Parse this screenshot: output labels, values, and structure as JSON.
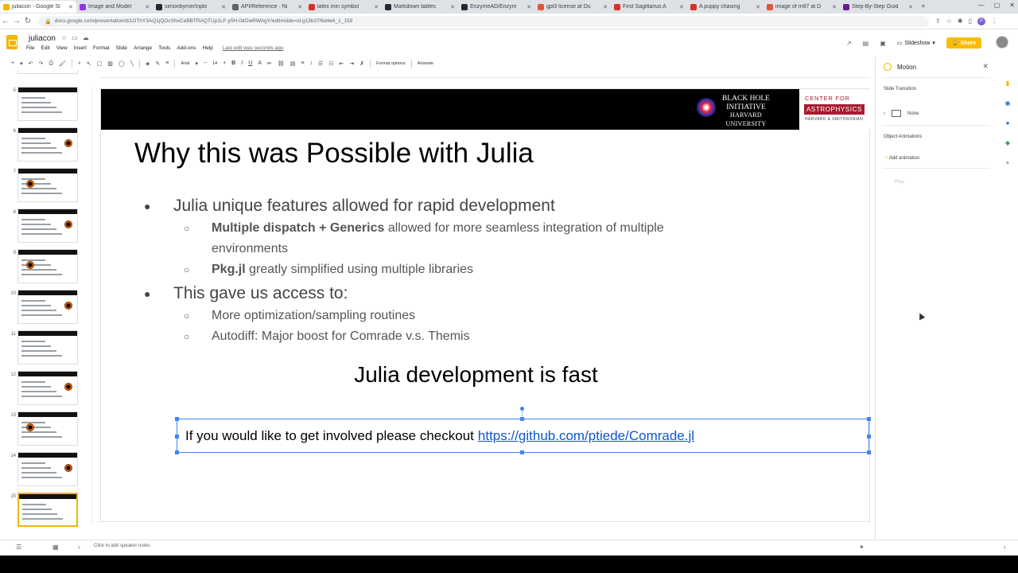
{
  "browser": {
    "tabs": [
      {
        "title": "juliacon - Google Sl",
        "color": "#f4b400",
        "active": true
      },
      {
        "title": "Image and Model",
        "color": "#9334e6"
      },
      {
        "title": "simonbyrne/Inplo",
        "color": "#24292f"
      },
      {
        "title": "API/Reference · Ni",
        "color": "#5f6368"
      },
      {
        "title": "latex min symbol",
        "color": "#d93025"
      },
      {
        "title": "Markdown tables",
        "color": "#24292f"
      },
      {
        "title": "EnzymeAD/Enzym",
        "color": "#24292f"
      },
      {
        "title": "gpl3 license at Du",
        "color": "#de5833"
      },
      {
        "title": "First Sagittarius A",
        "color": "#d93025"
      },
      {
        "title": "A puppy chasing",
        "color": "#d93025"
      },
      {
        "title": "image of m87 at D",
        "color": "#de5833"
      },
      {
        "title": "Step-By-Step Guid",
        "color": "#6a1b9a"
      }
    ],
    "new_tab": "+",
    "url": "docs.google.com/presentation/d/1OThY3AQ1jQOcShxCeBBTRAQTUp1LF-y5H-0dOwRWAgY/edit#slide=id.g13b37f6d4e6_1_159"
  },
  "doc": {
    "name": "juliacon",
    "menus": [
      "File",
      "Edit",
      "View",
      "Insert",
      "Format",
      "Slide",
      "Arrange",
      "Tools",
      "Add-ons",
      "Help"
    ],
    "last_edit": "Last edit was seconds ago",
    "slideshow": "Slideshow",
    "share": "Share"
  },
  "edit_toolbar": {
    "font": "Arial",
    "font_size": "14",
    "format_options": "Format options",
    "animate": "Animate"
  },
  "filmstrip": {
    "numbers": [
      "5",
      "6",
      "7",
      "8",
      "9",
      "10",
      "11",
      "12",
      "13",
      "14",
      "15"
    ]
  },
  "slide": {
    "header_logo_left": {
      "line1": "BLACK HOLE",
      "line2": "INITIATIVE",
      "line3": "HARVARD UNIVERSITY"
    },
    "header_logo_right": {
      "top": "CENTER FOR",
      "mid": "ASTROPHYSICS",
      "bot": "HARVARD & SMITHSONIAN"
    },
    "title": "Why this was Possible with Julia",
    "bullets": {
      "b1": "Julia unique features allowed for rapid development",
      "b1_s1_bold": "Multiple dispatch + Generics",
      "b1_s1_rest": " allowed for more seamless integration of multiple environments",
      "b1_s2_bold": "Pkg.jl",
      "b1_s2_rest": " greatly simplified using multiple libraries",
      "b2": "This gave us access to:",
      "b2_s1": "More optimization/sampling routines",
      "b2_s2": "Autodiff: Major boost for Comrade v.s. Themis"
    },
    "fast": "Julia development is fast",
    "textbox_text": "If you would like to get involved please checkout",
    "textbox_link": "https://github.com/ptiede/Comrade.jl"
  },
  "motion_panel": {
    "title": "Motion",
    "slide_transition": "Slide Transition",
    "transition_value": "None",
    "object_animations": "Object Animations",
    "add_animation": "Add animation",
    "play": "Play"
  },
  "notes": {
    "placeholder": "Click to add speaker notes"
  }
}
